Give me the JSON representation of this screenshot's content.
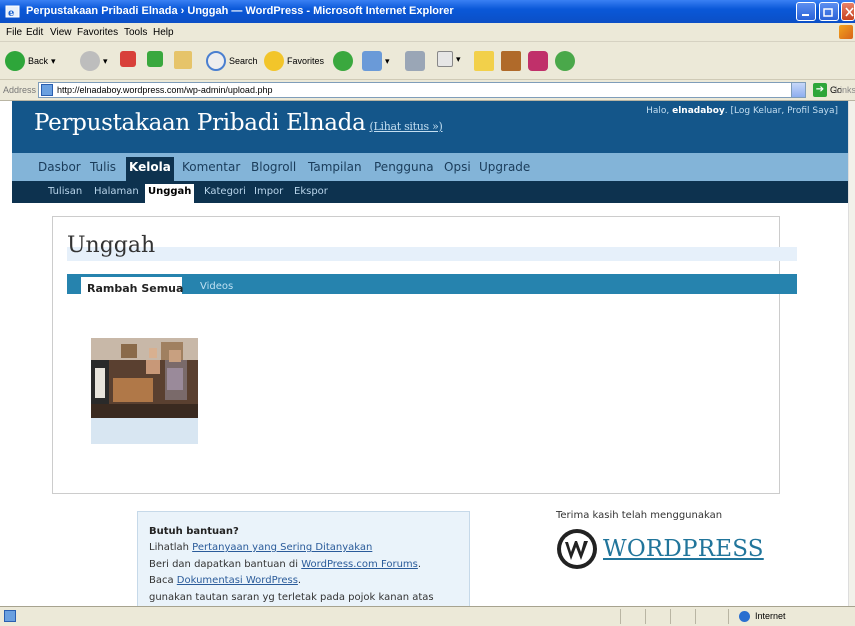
{
  "window": {
    "title": "Perpustakaan Pribadi Elnada › Unggah — WordPress - Microsoft Internet Explorer"
  },
  "menubar": {
    "items": [
      "File",
      "Edit",
      "View",
      "Favorites",
      "Tools",
      "Help"
    ]
  },
  "toolbar": {
    "back": "Back",
    "search": "Search",
    "favorites": "Favorites"
  },
  "address": {
    "label": "Address",
    "url": "http://elnadaboy.wordpress.com/wp-admin/upload.php",
    "go": "Go",
    "links": "Links"
  },
  "wp": {
    "site_title": "Perpustakaan Pribadi Elnada",
    "view_site": "(Lihat situs »)",
    "greeting": "Halo, ",
    "username": "elnadaboy",
    "user_links": ". [Log Keluar, Profil Saya]",
    "admin_menu": [
      "Dasbor",
      "Tulis",
      "Kelola",
      "Komentar",
      "Blogroll",
      "Tampilan",
      "Pengguna",
      "Opsi",
      "Upgrade"
    ],
    "sub_menu": [
      "Tulisan",
      "Halaman",
      "Unggah",
      "Kategori",
      "Impor",
      "Ekspor"
    ],
    "page_heading": "Unggah",
    "tabs": [
      "Rambah Semua",
      "Videos"
    ],
    "help": {
      "heading": "Butuh bantuan?",
      "line1_prefix": "Lihatlah ",
      "line1_link": "Pertanyaan yang Sering Ditanyakan",
      "line2_prefix": "Beri dan dapatkan bantuan di ",
      "line2_link": "WordPress.com Forums",
      "line2_suffix": ".",
      "line3_prefix": "Baca ",
      "line3_link": "Dokumentasi WordPress",
      "line3_suffix": ".",
      "line4": "gunakan tautan saran yg terletak pada pojok kanan atas"
    },
    "thanks": "Terima kasih telah menggunakan",
    "logo_text": "WORDPRESS"
  },
  "statusbar": {
    "zone": "Internet"
  },
  "colors": {
    "titlebar": "#0a58d8",
    "wp_header": "#14568a",
    "admin_menu": "#83b4d8",
    "submenu": "#0d324f",
    "tab_bar": "#2683ae"
  }
}
